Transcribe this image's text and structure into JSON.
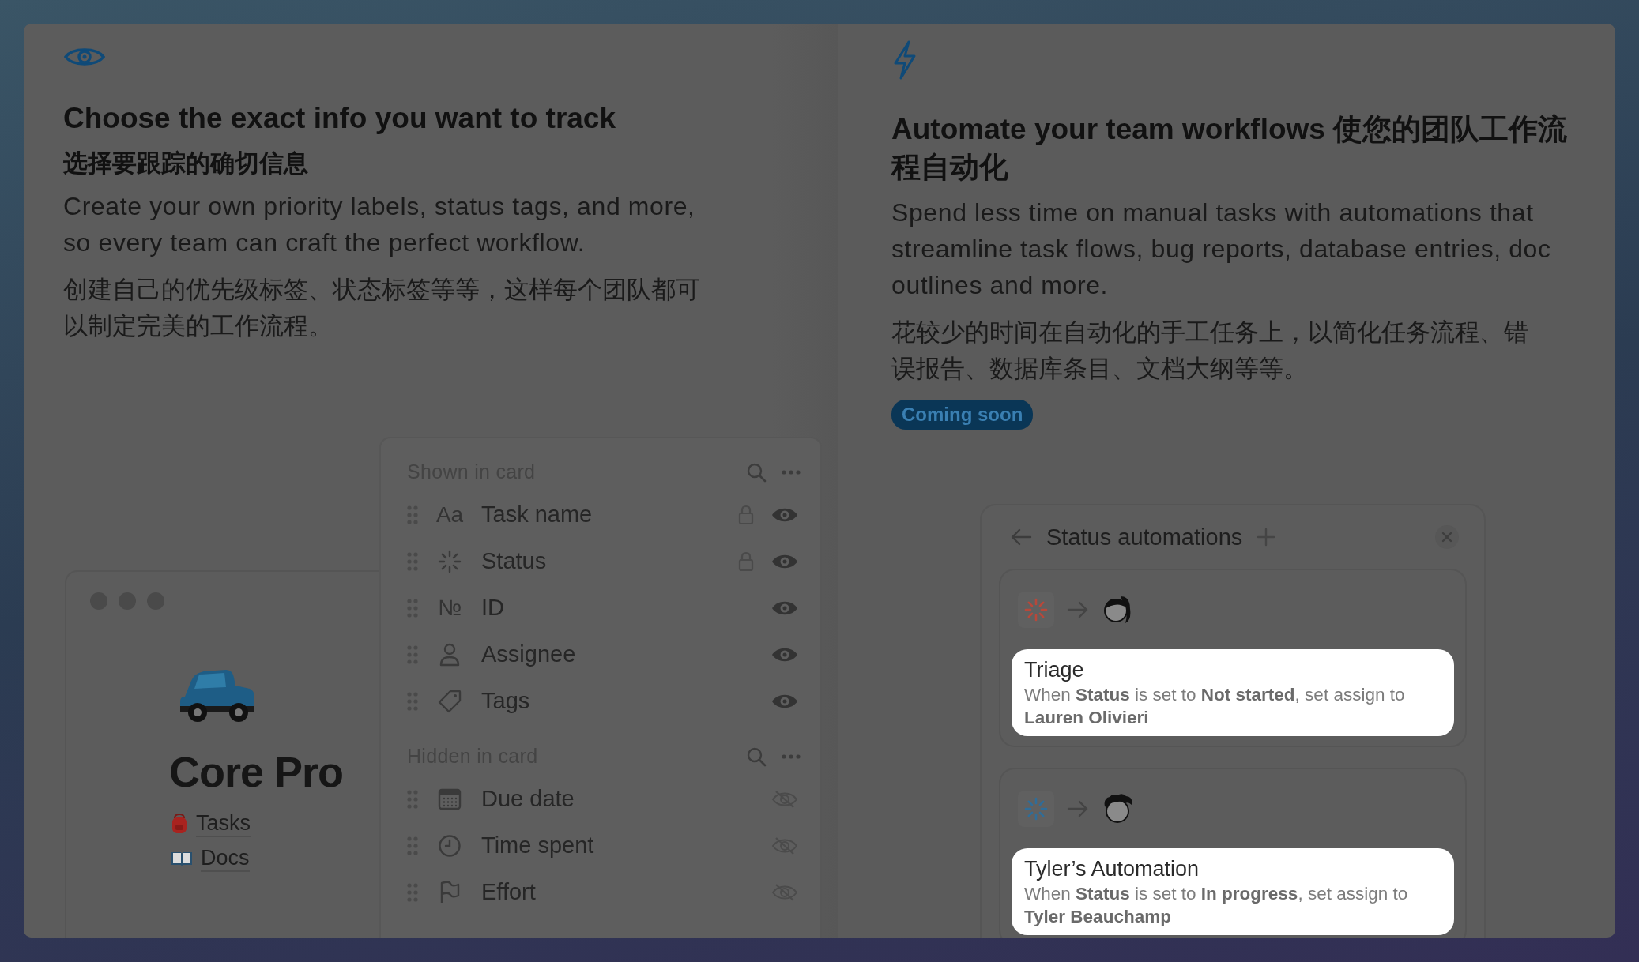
{
  "features": [
    {
      "kind": "eye",
      "title": "Choose the exact info you want to track",
      "subtitle": "选择要跟踪的确切信息",
      "body": "Create your own priority labels, status tags, and more, so every team can craft the perfect workflow.",
      "body_zh": "创建自己的优先级标签、状态标签等等，这样每个团队都可以制定完美的工作流程。"
    },
    {
      "kind": "bolt",
      "title": "Automate your team workflows 使您的团队工作流程自动化",
      "body": "Spend less time on manual tasks with automations that streamline task flows, bug reports, database entries, doc outlines and more.",
      "body_zh": "花较少的时间在自动化的手工任务上，以简化任务流程、错误报告、数据库条目、文档大纲等等。",
      "badge": "Coming soon"
    }
  ],
  "page_preview": {
    "title": "Core Pro",
    "links": [
      {
        "kind": "backpack",
        "label": "Tasks"
      },
      {
        "kind": "book",
        "label": "Docs"
      }
    ]
  },
  "properties_panel": {
    "sections": [
      {
        "heading": "Shown in card",
        "items": [
          {
            "kind": "text",
            "glyph": "Aa",
            "label": "Task name",
            "locked": true,
            "visible": true
          },
          {
            "kind": "status",
            "label": "Status",
            "locked": true,
            "visible": true
          },
          {
            "kind": "number",
            "glyph": "№",
            "label": "ID",
            "locked": false,
            "visible": true
          },
          {
            "kind": "person",
            "label": "Assignee",
            "locked": false,
            "visible": true
          },
          {
            "kind": "tags",
            "label": "Tags",
            "locked": false,
            "visible": true
          }
        ]
      },
      {
        "heading": "Hidden in card",
        "items": [
          {
            "kind": "date",
            "label": "Due date",
            "locked": false,
            "visible": false
          },
          {
            "kind": "clock",
            "label": "Time spent",
            "locked": false,
            "visible": false
          },
          {
            "kind": "flag",
            "label": "Effort",
            "locked": false,
            "visible": false
          }
        ]
      }
    ]
  },
  "automations_panel": {
    "title": "Status automations",
    "rules": [
      {
        "color": "#b8483a",
        "kind": "ponytail",
        "title": "Triage",
        "description": "When **Status** is set to **Not started**, set assign to **Lauren Olivieri**"
      },
      {
        "color": "#2f6d99",
        "kind": "curly",
        "title": "Tyler’s Automation",
        "description": "When **Status** is set to **In progress**, set assign to **Tyler Beauchamp**"
      }
    ]
  }
}
